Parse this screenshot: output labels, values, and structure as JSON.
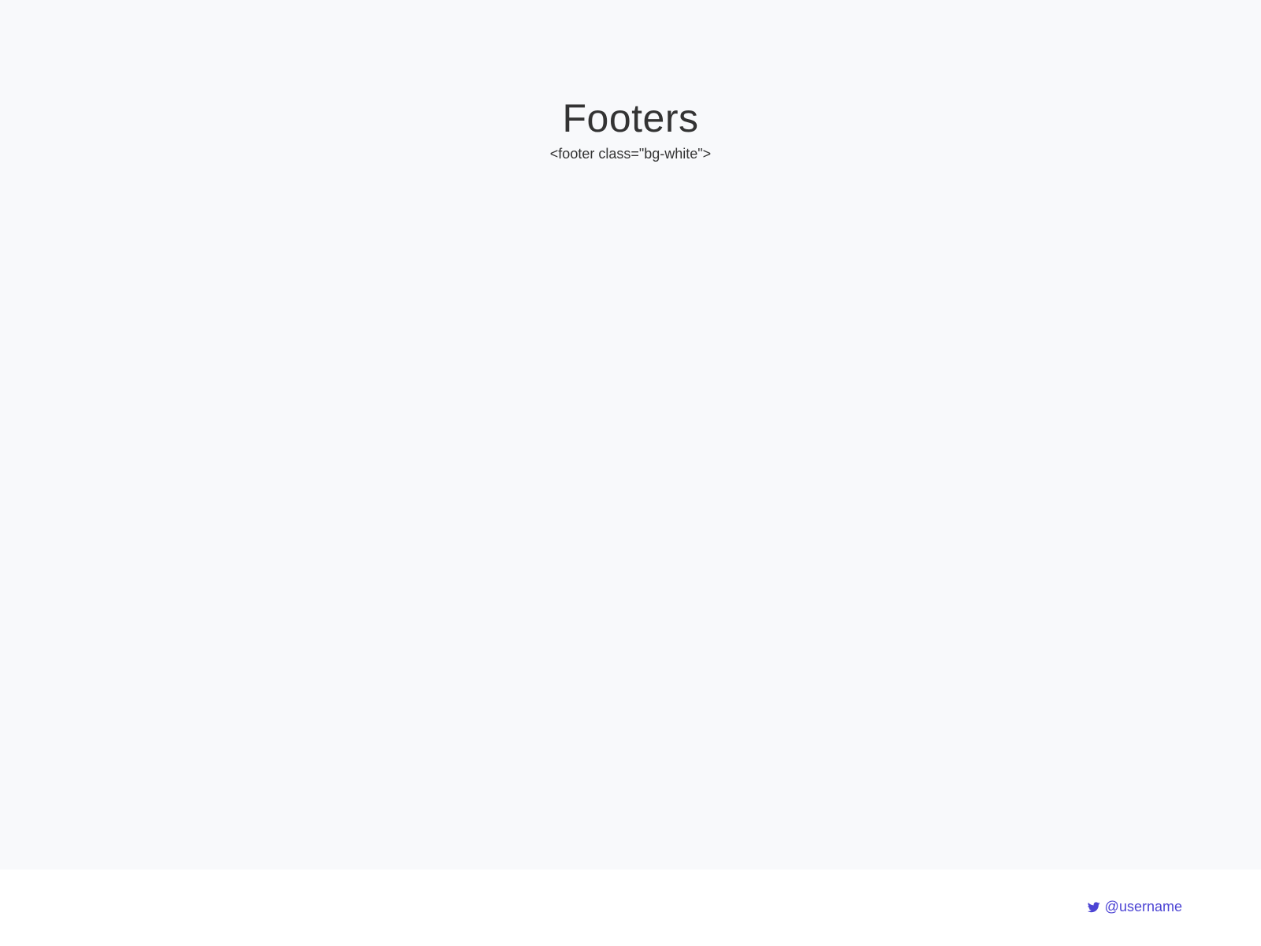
{
  "page": {
    "title": "Footers",
    "code_caption": "<footer class=\"bg-white\">"
  },
  "footer": {
    "link_icon": "twitter-icon",
    "link_text": "@username"
  },
  "colors": {
    "page_background": "#f8f9fb",
    "footer_background": "#ffffff",
    "text": "#333333",
    "link": "#4c44d4"
  }
}
